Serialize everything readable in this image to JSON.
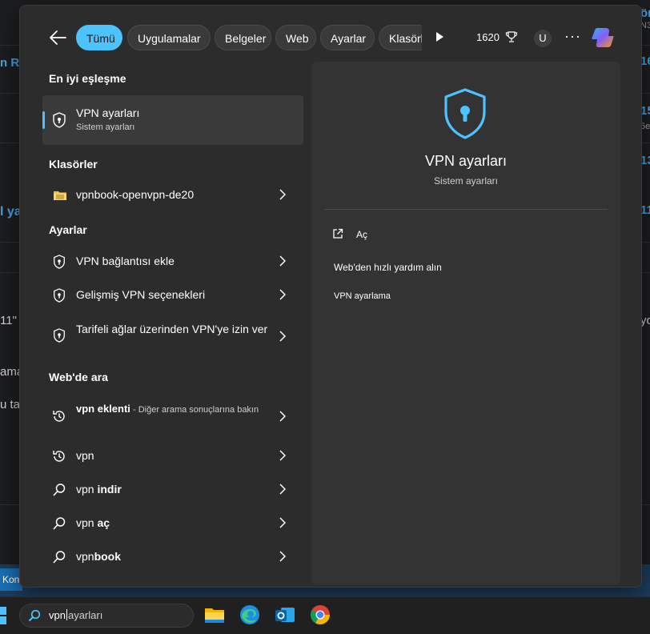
{
  "search_panel": {
    "filters": [
      "Tümü",
      "Uygulamalar",
      "Belgeler",
      "Web",
      "Ayarlar",
      "Klasörl"
    ],
    "points": "1620",
    "avatar_initial": "U",
    "more_label": "···",
    "accent_color": "#4cc2ff",
    "best_match": {
      "section": "En iyi eşleşme",
      "title": "VPN ayarları",
      "subtitle": "Sistem ayarları"
    },
    "folders": {
      "section": "Klasörler",
      "items": [
        {
          "label": "vpnbook-openvpn-de20"
        }
      ]
    },
    "settings": {
      "section": "Ayarlar",
      "items": [
        {
          "label": "VPN bağlantısı ekle"
        },
        {
          "label": "Gelişmiş VPN seçenekleri"
        },
        {
          "label": "Tarifeli ağlar üzerinden VPN'ye izin ver"
        }
      ]
    },
    "web": {
      "section": "Web'de ara",
      "items": [
        {
          "bold": "vpn eklenti",
          "suffix": " - Diğer arama sonuçlarına bakın",
          "icon": "history-icon"
        },
        {
          "plain": "vpn",
          "bold": "",
          "icon": "history-icon"
        },
        {
          "plain": "vpn ",
          "bold": "indir",
          "icon": "search-icon"
        },
        {
          "plain": "vpn ",
          "bold": "aç",
          "icon": "search-icon"
        },
        {
          "plain": "vpn",
          "bold": "book",
          "icon": "search-icon"
        }
      ]
    },
    "preview": {
      "title": "VPN ayarları",
      "subtitle": "Sistem ayarları",
      "actions": [
        "Aç",
        "Web'den hızlı yardım alın",
        "VPN ayarlama"
      ]
    }
  },
  "taskbar": {
    "search_typed": "vpn",
    "search_completion": "ayarları",
    "apps": [
      "file-explorer-icon",
      "edge-icon",
      "outlook-icon",
      "chrome-icon"
    ]
  },
  "background": {
    "fragments": [
      "n Ro",
      "l ya",
      "11\"",
      "ama",
      "u ta",
      "Kon",
      "ön",
      "N3",
      "16",
      "15",
      "5e",
      "13",
      "11",
      "yo"
    ]
  }
}
